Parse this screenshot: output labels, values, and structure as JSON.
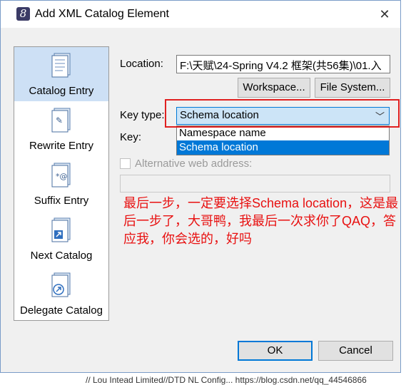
{
  "window": {
    "title": "Add XML Catalog Element",
    "app_icon": "eclipse-logo-icon",
    "close_glyph": "✕"
  },
  "sidebar": {
    "items": [
      {
        "label": "Catalog Entry",
        "icon": "catalog-entry-icon",
        "selected": true
      },
      {
        "label": "Rewrite Entry",
        "icon": "rewrite-entry-icon",
        "selected": false
      },
      {
        "label": "Suffix Entry",
        "icon": "suffix-entry-icon",
        "selected": false
      },
      {
        "label": "Next Catalog",
        "icon": "next-catalog-icon",
        "selected": false
      },
      {
        "label": "Delegate Catalog",
        "icon": "delegate-catalog-icon",
        "selected": false
      }
    ]
  },
  "form": {
    "location_label": "Location:",
    "location_value": "F:\\天赋\\24-Spring V4.2 框架(共56集)\\01.入",
    "workspace_button": "Workspace...",
    "filesystem_button": "File System...",
    "key_type_label": "Key type:",
    "key_type_value": "Schema location",
    "key_type_options": [
      "Namespace name",
      "Schema location"
    ],
    "key_type_selected_index": 1,
    "key_label": "Key:",
    "alt_web_label": "Alternative web address:",
    "alt_web_value": ""
  },
  "annotation": {
    "text": "最后一步，一定要选择Schema location，这是最后一步了，大哥鸭，我最后一次求你了QAQ，答应我，你会选的，好吗"
  },
  "footer": {
    "ok_button": "OK",
    "cancel_button": "Cancel"
  },
  "background": {
    "bottom_text": "// Lou Intead Limited//DTD NL Config... https://blog.csdn.net/qq_44546866"
  },
  "colors": {
    "selection": "#0078d7",
    "annotation": "#e81010",
    "highlight_box": "#e02020",
    "sidebar_selected": "#cde0f5"
  }
}
